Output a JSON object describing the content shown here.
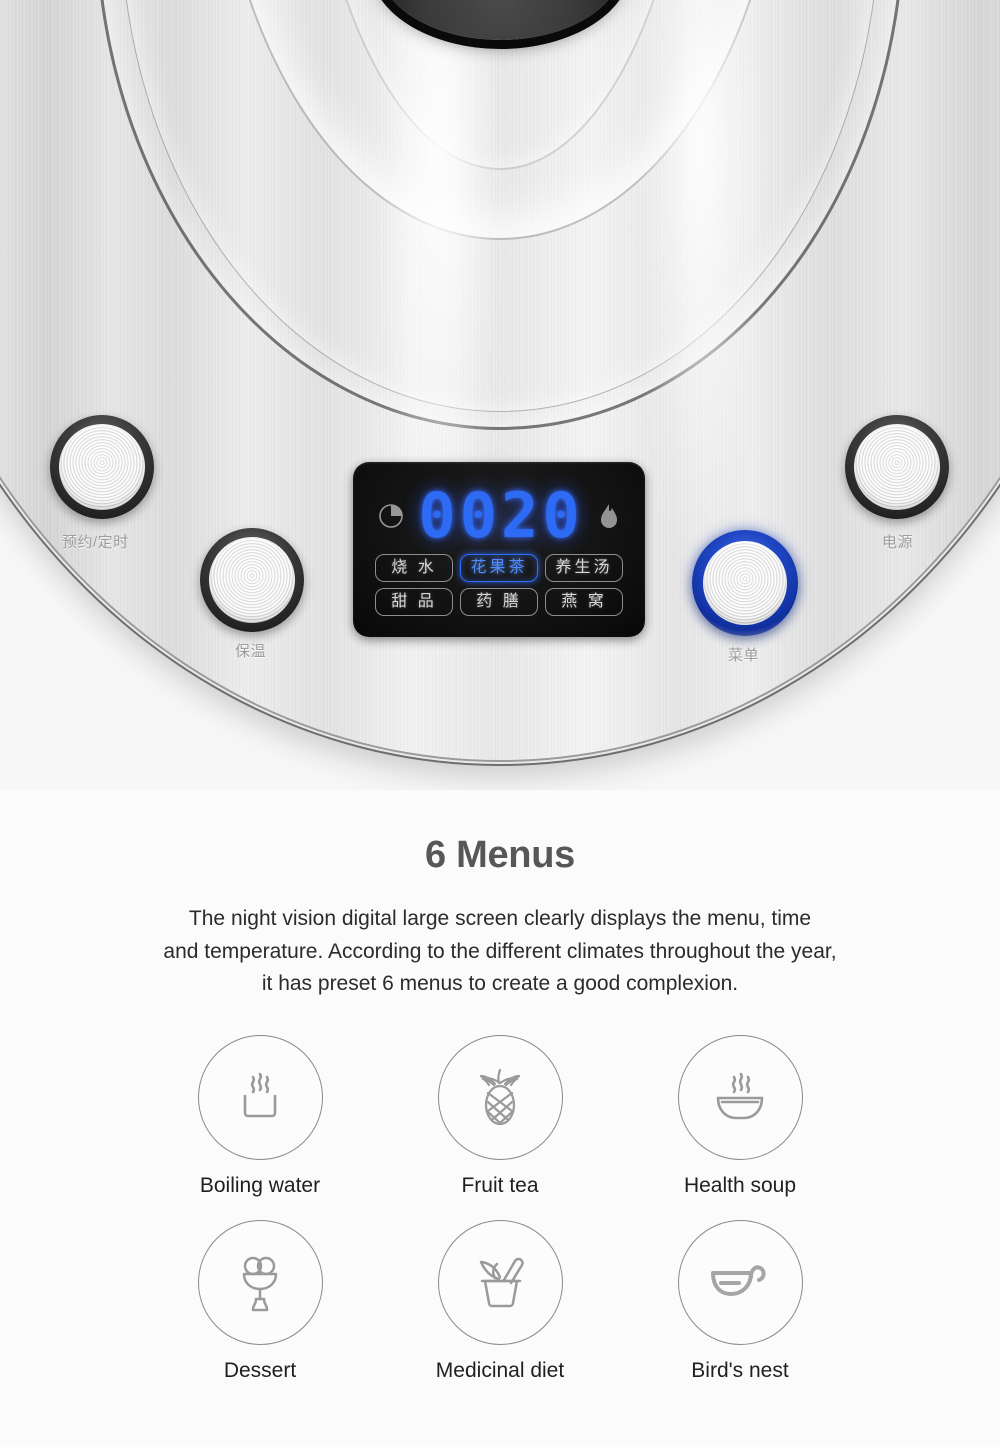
{
  "product_photo": {
    "device": "electric-kettle-control-panel",
    "buttons": [
      {
        "id": "timer",
        "label": "预约/定时",
        "state": "off"
      },
      {
        "id": "keep-warm",
        "label": "保温",
        "state": "off"
      },
      {
        "id": "menu",
        "label": "菜单",
        "state": "illuminated-blue"
      },
      {
        "id": "power",
        "label": "电源",
        "state": "off"
      }
    ],
    "display": {
      "value": "0020",
      "digit_color": "#2d6bf5",
      "clock_icon": "clock-icon",
      "droplet_icon": "droplet-icon",
      "menu_chips_row1": [
        {
          "label": "烧 水",
          "active": false
        },
        {
          "label": "花果茶",
          "active": true
        },
        {
          "label": "养生汤",
          "active": false
        }
      ],
      "menu_chips_row2": [
        {
          "label": "甜 品",
          "active": false
        },
        {
          "label": "药 膳",
          "active": false
        },
        {
          "label": "燕 窝",
          "active": false
        }
      ]
    }
  },
  "section": {
    "title": "6 Menus",
    "title_color": "#575757",
    "description_lines": [
      "The night vision digital large screen clearly displays the menu, time",
      "and temperature. According to the different climates throughout the year,",
      "it has preset 6 menus to create a good complexion."
    ],
    "menus": [
      {
        "label": "Boiling water",
        "icon": "steaming-pot-icon"
      },
      {
        "label": "Fruit tea",
        "icon": "pineapple-icon"
      },
      {
        "label": "Health soup",
        "icon": "steaming-bowl-icon"
      },
      {
        "label": "Dessert",
        "icon": "ice-cream-goblet-icon"
      },
      {
        "label": "Medicinal diet",
        "icon": "mortar-pestle-icon"
      },
      {
        "label": "Bird's nest",
        "icon": "nest-bowl-icon"
      }
    ]
  }
}
